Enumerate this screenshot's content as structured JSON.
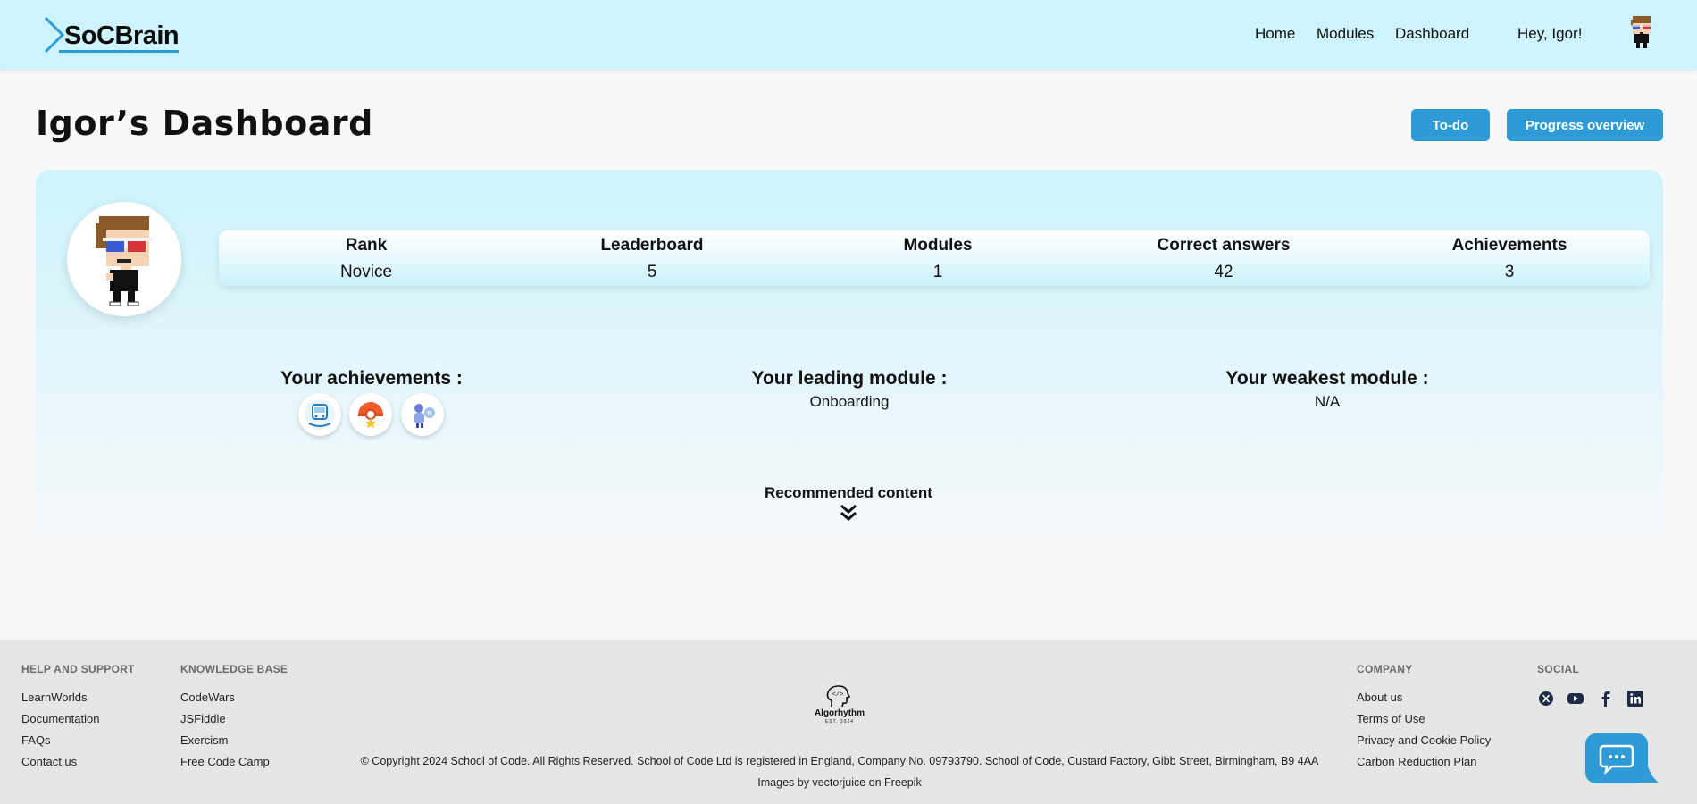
{
  "header": {
    "logo_text": "SoCBrain",
    "nav": [
      {
        "label": "Home"
      },
      {
        "label": "Modules"
      },
      {
        "label": "Dashboard"
      }
    ],
    "greeting": "Hey, Igor!"
  },
  "page": {
    "title": "Igor’s Dashboard",
    "buttons": {
      "todo": "To-do",
      "progress": "Progress overview"
    }
  },
  "stats": [
    {
      "label": "Rank",
      "value": "Novice"
    },
    {
      "label": "Leaderboard",
      "value": "5"
    },
    {
      "label": "Modules",
      "value": "1"
    },
    {
      "label": "Correct answers",
      "value": "42"
    },
    {
      "label": "Achievements",
      "value": "3"
    }
  ],
  "sections": {
    "achievements_title": "Your achievements :",
    "badges": [
      "train-badge-icon",
      "pokeball-badge-icon",
      "mascot-badge-icon"
    ],
    "leading_title": "Your leading module :",
    "leading_value": "Onboarding",
    "weakest_title": "Your weakest module :",
    "weakest_value": "N/A",
    "recommended": "Recommended content"
  },
  "footer": {
    "help": {
      "title": "HELP AND SUPPORT",
      "links": [
        "LearnWorlds",
        "Documentation",
        "FAQs",
        "Contact us"
      ]
    },
    "knowledge": {
      "title": "KNOWLEDGE BASE",
      "links": [
        "CodeWars",
        "JSFiddle",
        "Exercism",
        "Free Code Camp"
      ]
    },
    "company": {
      "title": "COMPANY",
      "links": [
        "About us",
        "Terms of Use",
        "Privacy and Cookie Policy",
        "Carbon Reduction Plan"
      ]
    },
    "social": {
      "title": "SOCIAL",
      "icons": [
        "x-icon",
        "youtube-icon",
        "facebook-icon",
        "linkedin-icon"
      ]
    },
    "logo_name": "Algorhythm",
    "logo_est": "EST. 2024",
    "copyright": "© Copyright 2024 School of Code. All Rights Reserved. School of Code Ltd is registered in England, Company No. 09793790. School of Code, Custard Factory, Gibb Street, Birmingham, B9 4AA",
    "credit": "Images by vectorjuice on Freepik"
  },
  "colors": {
    "header_bg": "#cdf3fc",
    "accent": "#2e9ad6",
    "footer_bg": "#e5e6e6"
  }
}
